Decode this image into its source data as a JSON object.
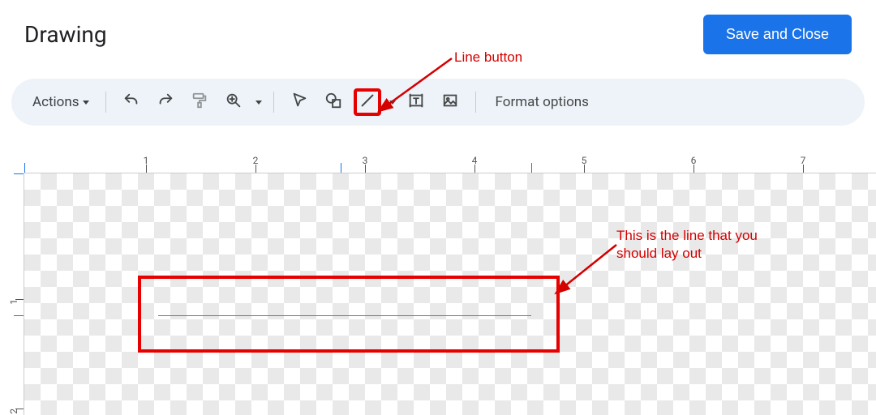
{
  "header": {
    "title": "Drawing",
    "save_label": "Save and Close"
  },
  "toolbar": {
    "actions_label": "Actions",
    "format_options_label": "Format options"
  },
  "ruler": {
    "h_numbers": [
      "1",
      "2",
      "3",
      "4",
      "5",
      "6",
      "7"
    ],
    "v_numbers": [
      "1",
      "2"
    ]
  },
  "annotations": {
    "line_button_label": "Line button",
    "line_callout_text": "This is the line that you should lay out"
  }
}
